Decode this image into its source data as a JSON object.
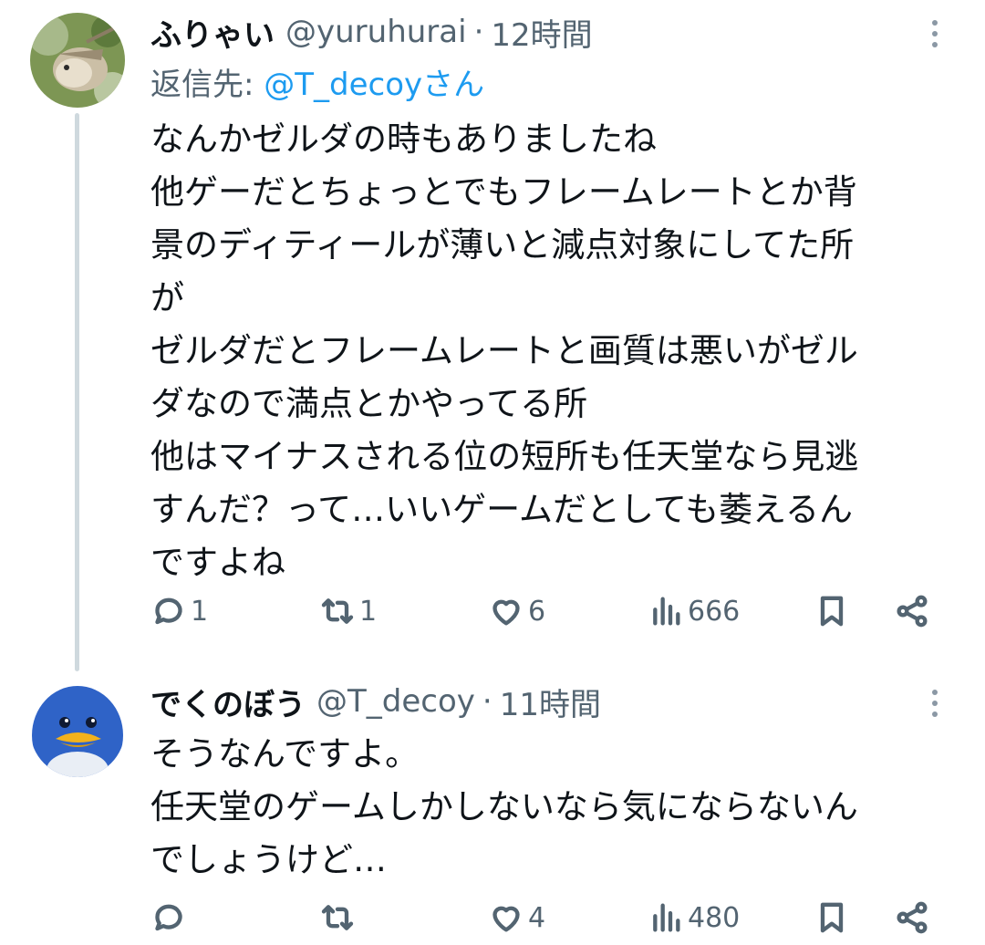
{
  "thread": {
    "tweets": [
      {
        "display_name": "ふりゃい",
        "handle": "@yuruhurai",
        "separator": "·",
        "time": "12時間",
        "reply_prefix": "返信先: ",
        "reply_mention": "@T_decoyさん",
        "body_lines": [
          "なんかゼルダの時もありましたね",
          "他ゲーだとちょっとでもフレームレートとか背",
          "景のディティールが薄いと減点対象にしてた所",
          "が",
          "ゼルダだとフレームレートと画質は悪いがゼル",
          "ダなので満点とかやってる所",
          "他はマイナスされる位の短所も任天堂なら見逃",
          "すんだ？って…いいゲームだとしても萎えるん",
          "ですよね"
        ],
        "reply_count": "1",
        "retweet_count": "1",
        "like_count": "6",
        "view_count": "666",
        "avatar_colors": {
          "bg": "#6f8a48",
          "body": "#d8ccb6"
        }
      },
      {
        "display_name": "でくのぼう",
        "handle": "@T_decoy",
        "separator": "·",
        "time": "11時間",
        "body_lines": [
          "そうなんですよ。",
          "任天堂のゲームしかしないなら気にならないん",
          "でしょうけど…"
        ],
        "reply_count": "",
        "retweet_count": "",
        "like_count": "4",
        "view_count": "480",
        "avatar_colors": {
          "bg": "#2f63c7",
          "beak": "#f2b21d"
        }
      }
    ]
  },
  "icons": {
    "reply": "reply-bubble-icon",
    "retweet": "retweet-arrows-icon",
    "like": "heart-icon",
    "views": "bar-chart-icon",
    "bookmark": "bookmark-icon",
    "share": "share-icon",
    "more": "vertical-dots-icon"
  },
  "colors": {
    "text": "#0f1419",
    "secondary": "#536471",
    "link": "#1d9bf0",
    "thread_line": "#cfd9de"
  }
}
